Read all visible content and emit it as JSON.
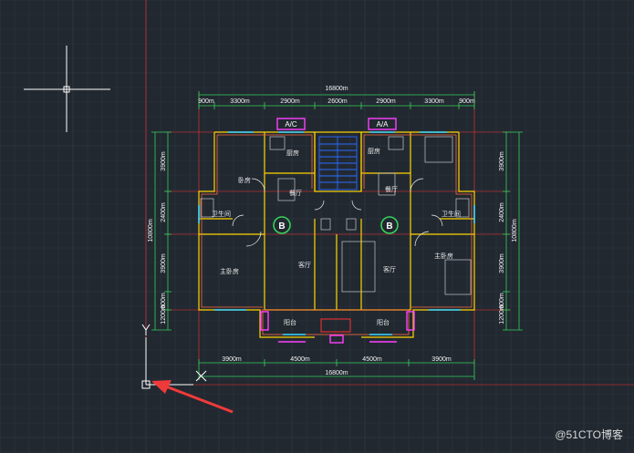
{
  "canvas": {
    "background": "#212830",
    "grid_color": "#2c343e",
    "grid_major_color": "#333c47"
  },
  "colors": {
    "wall": "#ffd400",
    "wall_inner": "#ff6a3d",
    "axis": "#ff3030",
    "dim": "#36d15a",
    "window": "#3ad7ff",
    "furniture": "#c8c8c8",
    "magenta": "#ff40ff",
    "stair": "#2b6cff",
    "door": "#f0f0f0",
    "arrow": "#f03a3a"
  },
  "top_dims": {
    "total": "16800m",
    "segments": [
      "900m",
      "3300m",
      "2900m",
      "2600m",
      "2900m",
      "3300m",
      "900m"
    ]
  },
  "bottom_dims": {
    "total": "16800m",
    "segments": [
      "3900m",
      "4500m",
      "4500m",
      "3900m"
    ]
  },
  "left_dims": {
    "total": "10800m",
    "segments": [
      "3900m",
      "2400m",
      "3900m",
      "1200m",
      "600m"
    ]
  },
  "right_dims": {
    "total": "10800m",
    "segments": [
      "3900m",
      "2400m",
      "3900m",
      "1200m",
      "600m"
    ]
  },
  "rooms": {
    "left_kitchen": "厨房",
    "left_dining": "餐厅",
    "left_bedroom_small": "卧房",
    "left_bath": "卫生间",
    "left_master": "主卧房",
    "left_living": "客厅",
    "left_balcony": "阳台",
    "right_kitchen": "厨房",
    "right_dining": "餐厅",
    "right_bath": "卫生间",
    "right_master": "主卧房",
    "right_living": "客厅",
    "right_balcony": "阳台"
  },
  "tags": {
    "ac_left": "A/C",
    "ac_right": "A/A"
  },
  "axis_markers": [
    "B",
    "B"
  ],
  "ucs": {
    "y": "Y",
    "x": "X"
  },
  "watermark": "@51CTO博客"
}
